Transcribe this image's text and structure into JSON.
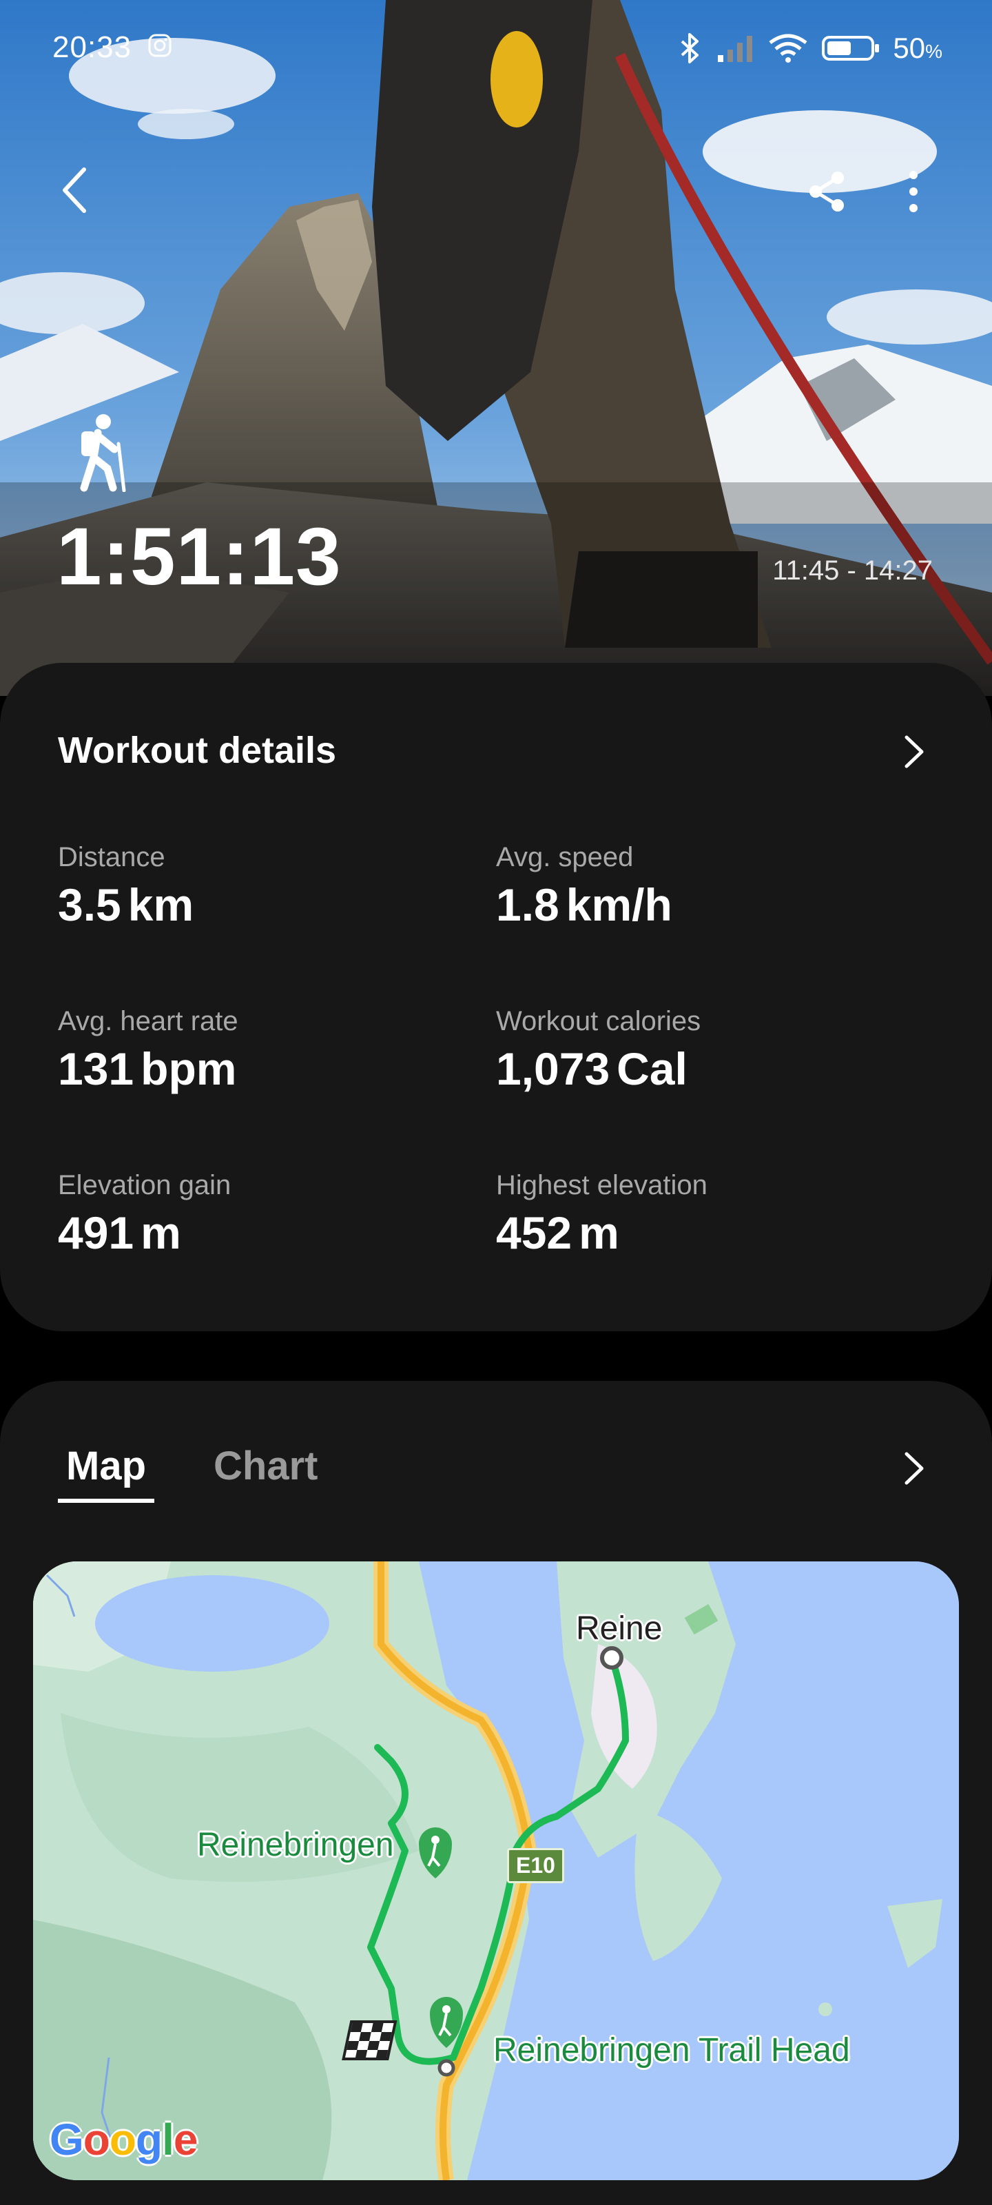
{
  "status_bar": {
    "time": "20:33",
    "battery_value": "50",
    "battery_unit": "%"
  },
  "icons": {
    "back": "chevron-left-icon",
    "share": "share-icon",
    "more": "more-vertical-icon",
    "activity": "hiking-icon"
  },
  "hero": {
    "duration": "1:51:13",
    "time_range": "11:45 - 14:27"
  },
  "workout_details": {
    "title": "Workout details",
    "stats": [
      {
        "label": "Distance",
        "value": "3.5",
        "unit": "km"
      },
      {
        "label": "Avg. speed",
        "value": "1.8",
        "unit": "km/h"
      },
      {
        "label": "Avg. heart rate",
        "value": "131",
        "unit": "bpm"
      },
      {
        "label": "Workout calories",
        "value": "1,073",
        "unit": "Cal"
      },
      {
        "label": "Elevation gain",
        "value": "491",
        "unit": "m"
      },
      {
        "label": "Highest elevation",
        "value": "452",
        "unit": "m"
      }
    ]
  },
  "map_card": {
    "tabs": [
      {
        "label": "Map",
        "active": true
      },
      {
        "label": "Chart",
        "active": false
      }
    ],
    "map": {
      "labels": {
        "town": "Reine",
        "peak": "Reinebringen",
        "trailhead": "Reinebringen Trail Head",
        "road": "E10"
      },
      "attribution": "Google",
      "route_color": "#1db954"
    }
  }
}
